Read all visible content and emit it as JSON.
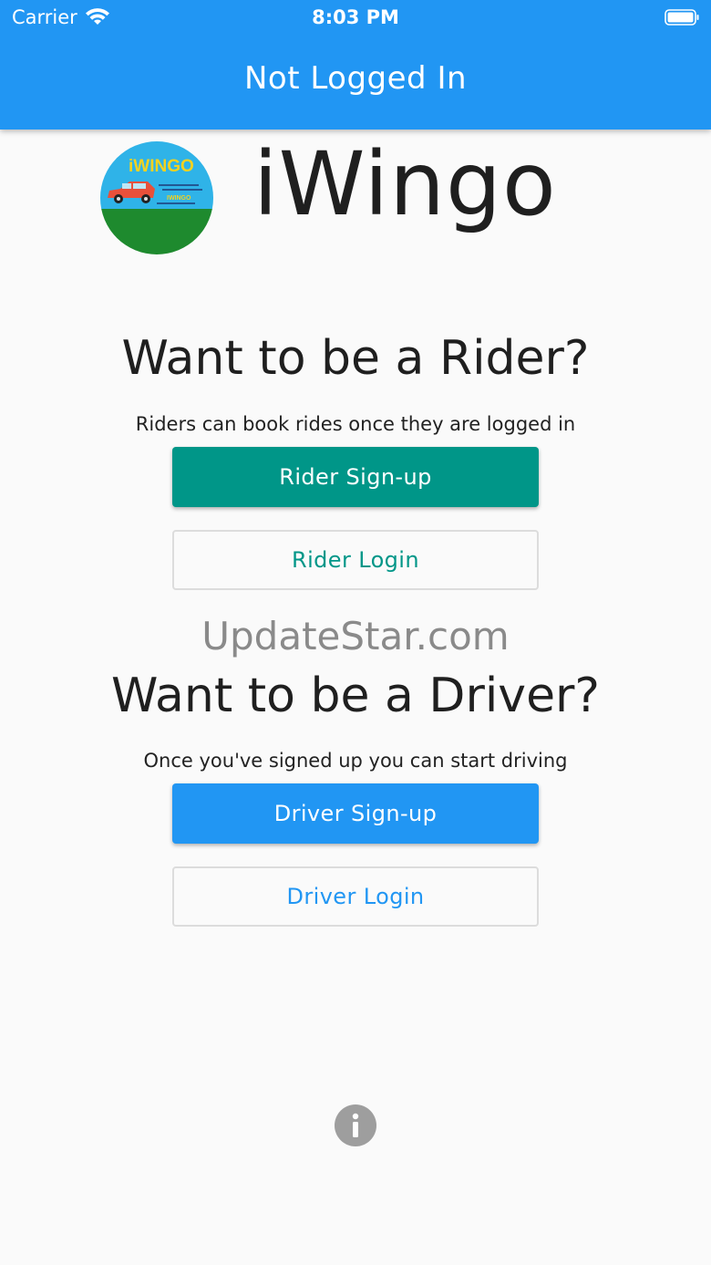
{
  "status_bar": {
    "carrier": "Carrier",
    "time": "8:03 PM"
  },
  "app_bar": {
    "title": "Not Logged In"
  },
  "brand": {
    "name": "iWingo",
    "logo_text": "iWINGO",
    "logo_small_text": "IWINGO"
  },
  "rider": {
    "title": "Want to be a Rider?",
    "subtitle": "Riders can book rides once they are logged in",
    "signup_label": "Rider Sign-up",
    "login_label": "Rider Login"
  },
  "watermark": "UpdateStar.com",
  "driver": {
    "title": "Want to be a Driver?",
    "subtitle": "Once you've signed up you can start driving",
    "signup_label": "Driver Sign-up",
    "login_label": "Driver Login"
  },
  "icons": {
    "wifi": "wifi-icon",
    "battery": "battery-icon",
    "info": "info-icon"
  },
  "colors": {
    "app_bar": "#2196f3",
    "rider_accent": "#009688",
    "driver_accent": "#2196f3",
    "info_icon": "#9e9e9e"
  }
}
